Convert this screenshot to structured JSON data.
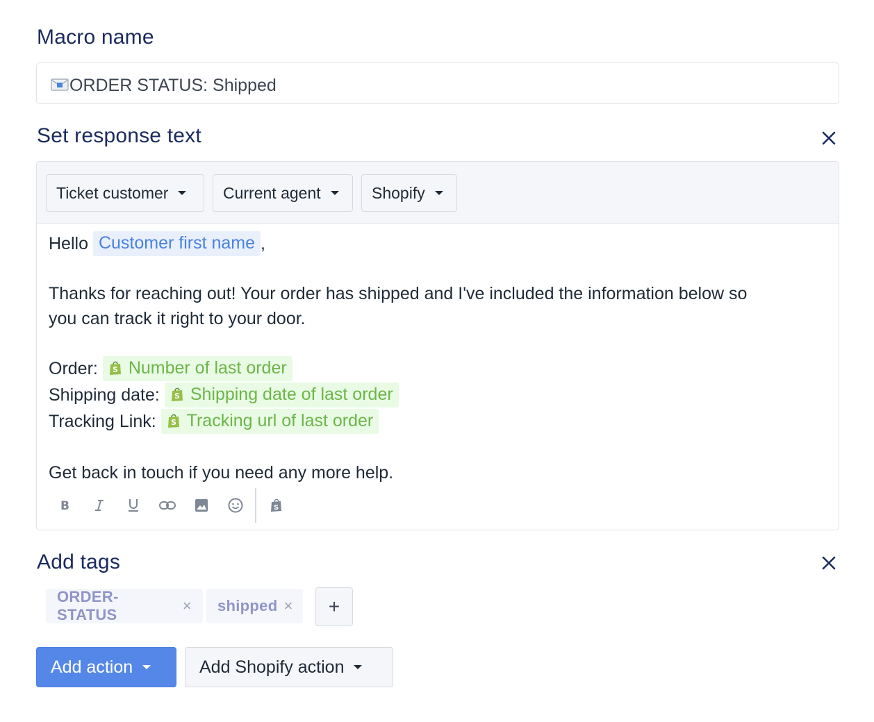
{
  "macro_name": {
    "title": "Macro name",
    "value": "ORDER STATUS: Shipped",
    "icon": "envelope-icon"
  },
  "response_text": {
    "title": "Set response text",
    "close_icon": "close-icon",
    "variables": [
      {
        "label": "Ticket customer"
      },
      {
        "label": "Current agent"
      },
      {
        "label": "Shopify"
      }
    ],
    "body": {
      "greeting": "Hello",
      "greeting_var": "Customer first name",
      "greeting_suffix": ",",
      "paragraph1_line1": "Thanks for reaching out! Your order has shipped and I've included the information below so",
      "paragraph1_line2": "you can track it right to your door.",
      "order_label": "Order:",
      "order_var": "Number of last order",
      "shipping_label": "Shipping date:",
      "shipping_var": "Shipping date of last order",
      "tracking_label": "Tracking Link:",
      "tracking_var": "Tracking url of last order",
      "closing": "Get back in touch if you need any more help."
    },
    "format_tools": [
      "bold-icon",
      "italic-icon",
      "underline-icon",
      "link-icon",
      "image-icon",
      "emoji-icon",
      "shopify-icon"
    ]
  },
  "tags": {
    "title": "Add tags",
    "items": [
      {
        "label": "ORDER-STATUS"
      },
      {
        "label": "shipped"
      }
    ],
    "remove_glyph": "×",
    "add_glyph": "+"
  },
  "actions": {
    "add_action": "Add action",
    "add_shopify_action": "Add Shopify action"
  },
  "colors": {
    "title": "#1b2a5e",
    "primary": "#5587e8",
    "variable_blue": "#4a82e0",
    "variable_green": "#6cb54a"
  }
}
